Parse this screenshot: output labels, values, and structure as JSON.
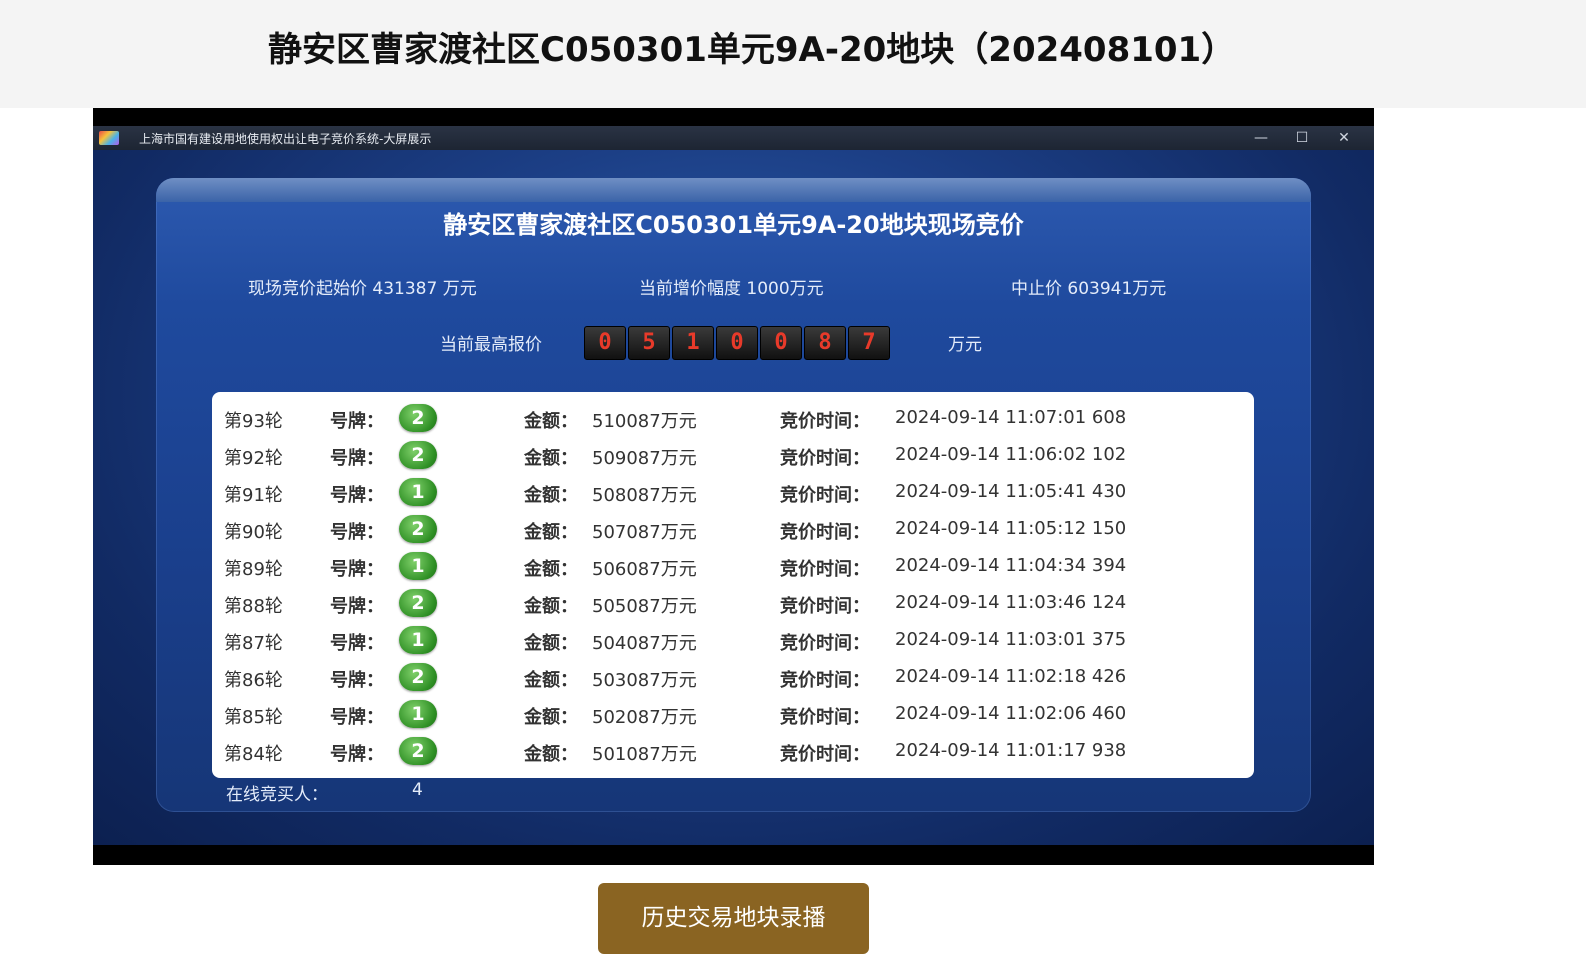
{
  "page": {
    "title": "静安区曹家渡社区C050301单元9A-20地块（202408101）"
  },
  "window": {
    "title": "上海市国有建设用地使用权出让电子竞价系统-大屏展示",
    "minimize": "—",
    "maximize": "☐",
    "close": "✕"
  },
  "board": {
    "title": "静安区曹家渡社区C050301单元9A-20地块现场竞价",
    "start_price": "现场竞价起始价 431387 万元",
    "increment": "当前增价幅度 1000万元",
    "stop_price": "中止价 603941万元",
    "highest_label": "当前最高报价",
    "highest_digits": [
      "0",
      "5",
      "1",
      "0",
      "0",
      "8",
      "7"
    ],
    "highest_unit": "万元",
    "online_label": "在线竞买人：",
    "online_count": "4"
  },
  "labels": {
    "plate": "号牌：",
    "amount": "金额：",
    "time": "竞价时间："
  },
  "bids": [
    {
      "round": "第93轮",
      "plate": "2",
      "amount": "510087万元",
      "time": "2024-09-14 11:07:01 608"
    },
    {
      "round": "第92轮",
      "plate": "2",
      "amount": "509087万元",
      "time": "2024-09-14 11:06:02 102"
    },
    {
      "round": "第91轮",
      "plate": "1",
      "amount": "508087万元",
      "time": "2024-09-14 11:05:41 430"
    },
    {
      "round": "第90轮",
      "plate": "2",
      "amount": "507087万元",
      "time": "2024-09-14 11:05:12 150"
    },
    {
      "round": "第89轮",
      "plate": "1",
      "amount": "506087万元",
      "time": "2024-09-14 11:04:34 394"
    },
    {
      "round": "第88轮",
      "plate": "2",
      "amount": "505087万元",
      "time": "2024-09-14 11:03:46 124"
    },
    {
      "round": "第87轮",
      "plate": "1",
      "amount": "504087万元",
      "time": "2024-09-14 11:03:01 375"
    },
    {
      "round": "第86轮",
      "plate": "2",
      "amount": "503087万元",
      "time": "2024-09-14 11:02:18 426"
    },
    {
      "round": "第85轮",
      "plate": "1",
      "amount": "502087万元",
      "time": "2024-09-14 11:02:06 460"
    },
    {
      "round": "第84轮",
      "plate": "2",
      "amount": "501087万元",
      "time": "2024-09-14 11:01:17 938"
    }
  ],
  "history_button": "历史交易地块录播"
}
